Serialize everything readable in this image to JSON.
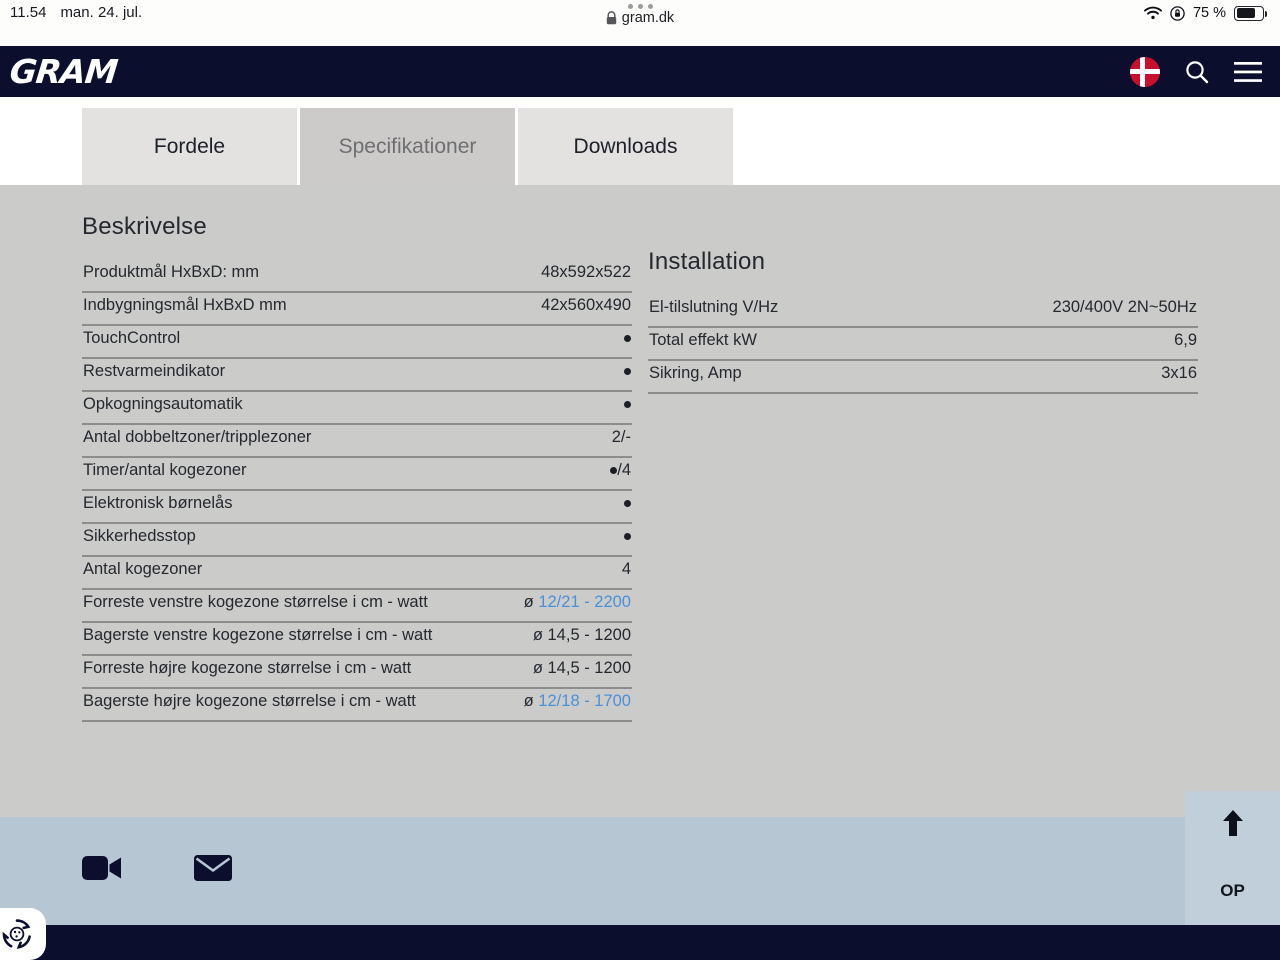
{
  "statusbar": {
    "time": "11.54",
    "date": "man. 24. jul.",
    "battery_percent": "75 %",
    "wifi_icon": "wifi-icon",
    "rotation_lock_icon": "rotation-lock-icon",
    "battery_icon": "battery-icon"
  },
  "browser": {
    "url": "gram.dk",
    "lock_icon": "lock-icon",
    "tab_overview_icon": "three-dots-icon"
  },
  "header": {
    "logo": "GRAM",
    "language_flag": "denmark-flag-icon",
    "search_icon": "search-icon",
    "menu_icon": "hamburger-menu-icon"
  },
  "tabs": [
    {
      "label": "Fordele",
      "active": false
    },
    {
      "label": "Specifikationer",
      "active": true
    },
    {
      "label": "Downloads",
      "active": false
    }
  ],
  "description": {
    "title": "Beskrivelse",
    "rows": [
      {
        "label": "Produktmål HxBxD: mm",
        "value": "48x592x522",
        "type": "text"
      },
      {
        "label": "Indbygningsmål HxBxD mm",
        "value": "42x560x490",
        "type": "text"
      },
      {
        "label": "TouchControl",
        "value": "●",
        "type": "bullet"
      },
      {
        "label": "Restvarmeindikator",
        "value": "●",
        "type": "bullet"
      },
      {
        "label": "Opkogningsautomatik",
        "value": "●",
        "type": "bullet"
      },
      {
        "label": "Antal dobbeltzoner/tripplezoner",
        "value": "2/-",
        "type": "text"
      },
      {
        "label": "Timer/antal kogezoner",
        "value": "●/4",
        "type": "bullet-text"
      },
      {
        "label": "Elektronisk børnelås",
        "value": "●",
        "type": "bullet"
      },
      {
        "label": "Sikkerhedsstop",
        "value": "●",
        "type": "bullet"
      },
      {
        "label": "Antal kogezoner",
        "value": "4",
        "type": "text"
      },
      {
        "label": "Forreste venstre kogezone størrelse i cm - watt",
        "value": "ø 12/21 - 2200",
        "prefix": "ø ",
        "link": "12/21 - 2200",
        "type": "link"
      },
      {
        "label": "Bagerste venstre kogezone størrelse i cm - watt",
        "value": "ø 14,5 - 1200",
        "type": "text"
      },
      {
        "label": "Forreste højre kogezone størrelse i cm - watt",
        "value": "ø 14,5 - 1200",
        "type": "text"
      },
      {
        "label": "Bagerste højre kogezone størrelse i cm - watt",
        "value": "ø 12/18 - 1700",
        "prefix": "ø ",
        "link": "12/18 - 1700",
        "type": "link"
      }
    ]
  },
  "installation": {
    "title": "Installation",
    "rows": [
      {
        "label": "El-tilslutning V/Hz",
        "value": "230/400V 2N~50Hz"
      },
      {
        "label": "Total effekt kW",
        "value": "6,9"
      },
      {
        "label": "Sikring, Amp",
        "value": "3x16"
      }
    ]
  },
  "footer": {
    "video_icon": "video-camera-icon",
    "mail_icon": "envelope-icon",
    "scroll_top_label": "OP",
    "scroll_top_icon": "arrow-up-icon",
    "cookie_icon": "cookie-settings-icon"
  },
  "colors": {
    "brand_navy": "#0b0f2d",
    "flag_red": "#c8102e",
    "link_blue": "#4a90d9",
    "content_bg": "#cbcbca",
    "footband_bg": "#b6c6d2"
  }
}
